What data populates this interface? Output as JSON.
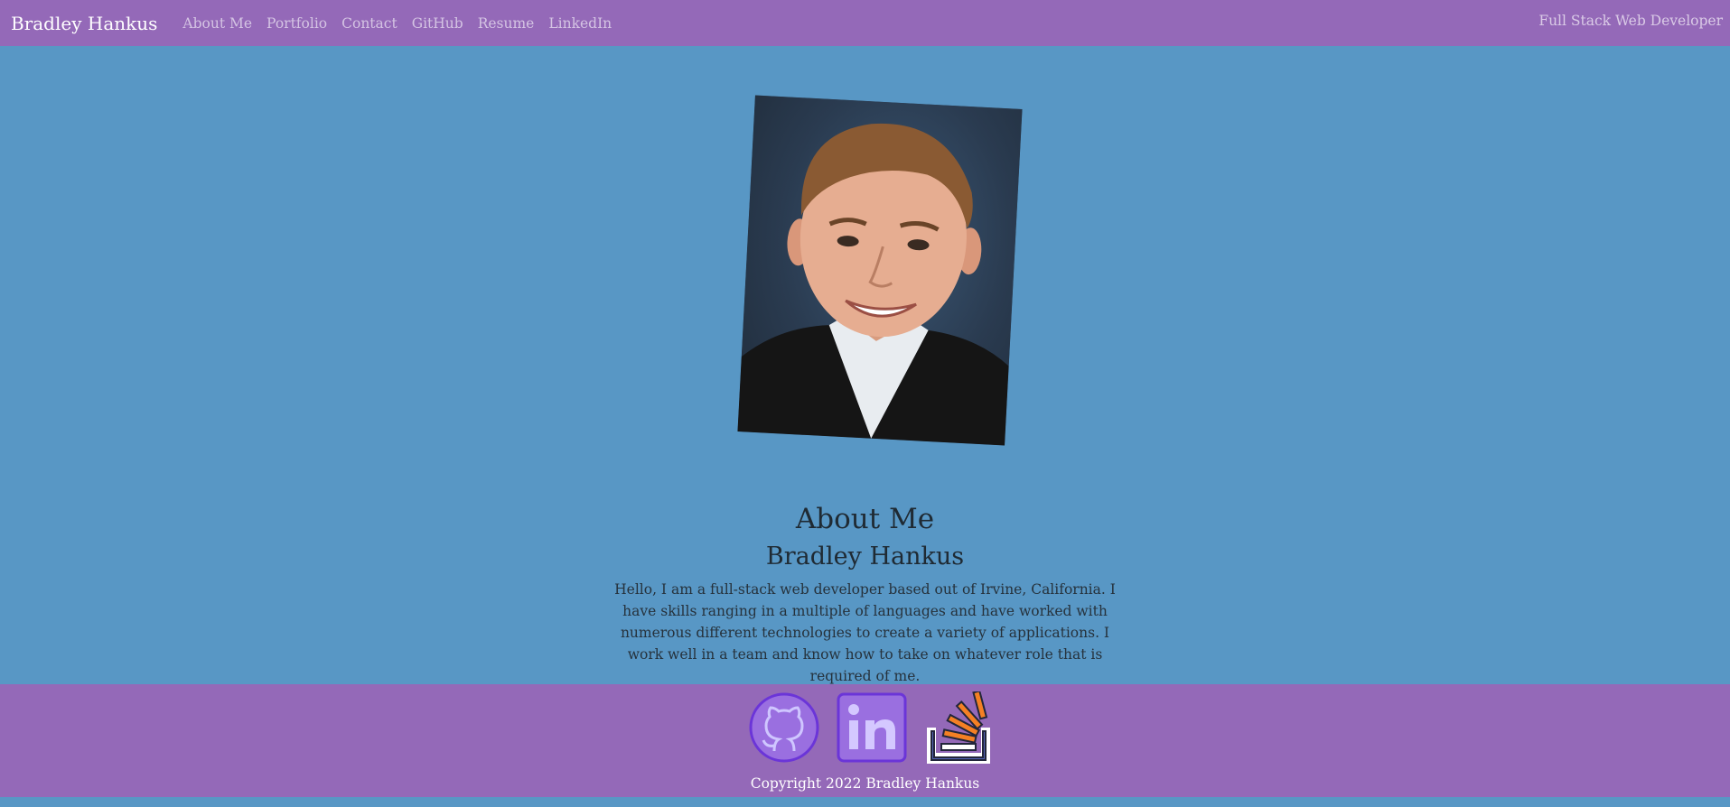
{
  "navbar": {
    "brand": "Bradley Hankus",
    "links": [
      "About Me",
      "Portfolio",
      "Contact",
      "GitHub",
      "Resume",
      "LinkedIn"
    ],
    "tagline": "Full Stack Web Developer"
  },
  "about": {
    "title": "About Me",
    "name": "Bradley Hankus",
    "text": "Hello, I am a full-stack web developer based out of Irvine, California. I have skills ranging in a multiple of languages and have worked with numerous different technologies to create a variety of applications. I work well in a team and know how to take on whatever role that is required of me."
  },
  "footer": {
    "icons": [
      "github-icon",
      "linkedin-icon",
      "stackoverflow-icon"
    ],
    "copyright": "Copyright 2022 Bradley Hankus"
  },
  "colors": {
    "background": "#5897c5",
    "navbar": "#9469b8",
    "footer": "#9469b8"
  }
}
